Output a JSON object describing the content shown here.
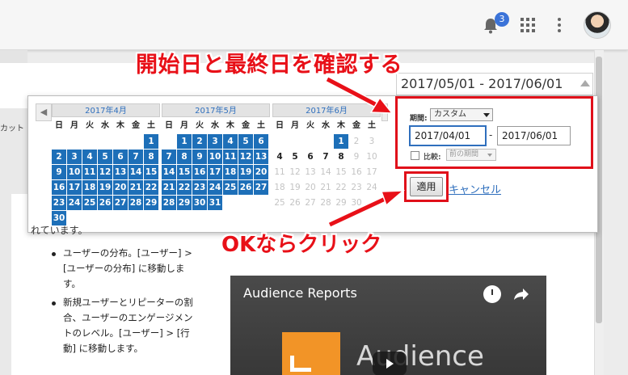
{
  "header": {
    "notification_count": "3"
  },
  "page": {
    "cut_text": "カット"
  },
  "date_range": {
    "value": "2017/05/01 - 2017/06/01"
  },
  "calendars": [
    {
      "title": "2017年4月",
      "weekdays": [
        "日",
        "月",
        "火",
        "水",
        "木",
        "金",
        "土"
      ],
      "weeks": [
        [
          "",
          "",
          "",
          "",
          "",
          "",
          "1"
        ],
        [
          "2",
          "3",
          "4",
          "5",
          "6",
          "7",
          "8"
        ],
        [
          "9",
          "10",
          "11",
          "12",
          "13",
          "14",
          "15"
        ],
        [
          "16",
          "17",
          "18",
          "19",
          "20",
          "21",
          "22"
        ],
        [
          "23",
          "24",
          "25",
          "26",
          "27",
          "28",
          "29"
        ],
        [
          "30",
          "",
          "",
          "",
          "",
          "",
          ""
        ]
      ]
    },
    {
      "title": "2017年5月",
      "weekdays": [
        "日",
        "月",
        "火",
        "水",
        "木",
        "金",
        "土"
      ],
      "weeks": [
        [
          "",
          "1",
          "2",
          "3",
          "4",
          "5",
          "6"
        ],
        [
          "7",
          "8",
          "9",
          "10",
          "11",
          "12",
          "13"
        ],
        [
          "14",
          "15",
          "16",
          "17",
          "18",
          "19",
          "20"
        ],
        [
          "21",
          "22",
          "23",
          "24",
          "25",
          "26",
          "27"
        ],
        [
          "28",
          "29",
          "30",
          "31",
          "",
          "",
          ""
        ],
        [
          "",
          "",
          "",
          "",
          "",
          "",
          ""
        ]
      ]
    },
    {
      "title": "2017年6月",
      "weekdays": [
        "日",
        "月",
        "火",
        "水",
        "木",
        "金",
        "土"
      ],
      "weeks": [
        [
          "",
          "",
          "",
          "",
          "1",
          "2",
          "3"
        ],
        [
          "4",
          "5",
          "6",
          "7",
          "8",
          "9",
          "10"
        ],
        [
          "11",
          "12",
          "13",
          "14",
          "15",
          "16",
          "17"
        ],
        [
          "18",
          "19",
          "20",
          "21",
          "22",
          "23",
          "24"
        ],
        [
          "25",
          "26",
          "27",
          "28",
          "29",
          "30",
          ""
        ],
        [
          "",
          "",
          "",
          "",
          "",
          "",
          ""
        ]
      ]
    }
  ],
  "settings": {
    "period_label": "期間:",
    "period_value": "カスタム",
    "start_date": "2017/04/01",
    "separator": "-",
    "end_date": "2017/06/01",
    "compare_label": "比較:",
    "compare_value": "前の期間"
  },
  "actions": {
    "apply": "適用",
    "cancel": "キャンセル"
  },
  "annotations": {
    "top": "開始日と最終日を確認する",
    "bottom": "OKならクリック"
  },
  "content": {
    "partial_line": "れています。",
    "bullets": [
      "ユーザーの分布。[ユーザー] > [ユーザーの分布] に移動します。",
      "新規ユーザーとリピーターの割合、ユーザーのエンゲージメントのレベル。[ユーザー] > [行動] に移動します。"
    ],
    "video_title": "Audience Reports",
    "video_logo_text": "Audience"
  },
  "colors": {
    "accent_blue": "#1d6fb8",
    "annotation_red": "#e81018",
    "link": "#2f6fbd"
  }
}
